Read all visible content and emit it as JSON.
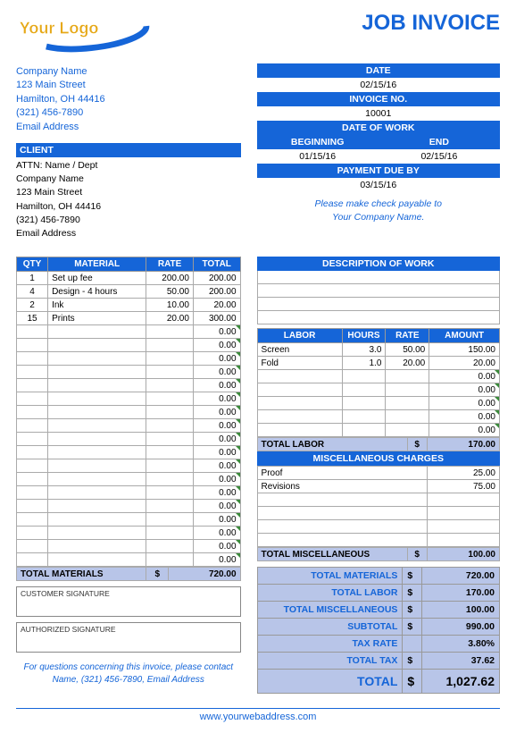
{
  "title": "JOB INVOICE",
  "logo_text_1": "Your",
  "logo_text_2": "Logo",
  "company": {
    "name": "Company Name",
    "street": "123 Main Street",
    "city": "Hamilton, OH  44416",
    "phone": "(321) 456-7890",
    "email": "Email Address"
  },
  "meta": {
    "date_label": "DATE",
    "date": "02/15/16",
    "invno_label": "INVOICE NO.",
    "invno": "10001",
    "dow_label": "DATE OF WORK",
    "beg_label": "BEGINNING",
    "end_label": "END",
    "beg": "01/15/16",
    "end": "02/15/16",
    "due_label": "PAYMENT DUE BY",
    "due": "03/15/16"
  },
  "client": {
    "header": "CLIENT",
    "attn": "ATTN: Name / Dept",
    "name": "Company Name",
    "street": "123 Main Street",
    "city": "Hamilton, OH  44416",
    "phone": "(321) 456-7890",
    "email": "Email Address"
  },
  "pay_note_1": "Please make check payable to",
  "pay_note_2": "Your Company Name.",
  "mat_headers": {
    "qty": "QTY",
    "mat": "MATERIAL",
    "rate": "RATE",
    "total": "TOTAL"
  },
  "materials": [
    {
      "qty": "1",
      "desc": "Set up fee",
      "rate": "200.00",
      "total": "200.00"
    },
    {
      "qty": "4",
      "desc": "Design - 4 hours",
      "rate": "50.00",
      "total": "200.00"
    },
    {
      "qty": "2",
      "desc": "Ink",
      "rate": "10.00",
      "total": "20.00"
    },
    {
      "qty": "15",
      "desc": "Prints",
      "rate": "20.00",
      "total": "300.00"
    }
  ],
  "mat_blank_rows": 18,
  "mat_total_label": "TOTAL MATERIALS",
  "mat_total": "720.00",
  "desc_header": "DESCRIPTION OF WORK",
  "labor_headers": {
    "labor": "LABOR",
    "hours": "HOURS",
    "rate": "RATE",
    "amount": "AMOUNT"
  },
  "labor": [
    {
      "desc": "Screen",
      "hours": "3.0",
      "rate": "50.00",
      "amount": "150.00"
    },
    {
      "desc": "Fold",
      "hours": "1.0",
      "rate": "20.00",
      "amount": "20.00"
    }
  ],
  "labor_blank_rows": 5,
  "labor_total_label": "TOTAL LABOR",
  "labor_total": "170.00",
  "misc_header": "MISCELLANEOUS CHARGES",
  "misc": [
    {
      "desc": "Proof",
      "amount": "25.00"
    },
    {
      "desc": "Revisions",
      "amount": "75.00"
    }
  ],
  "misc_blank_rows": 4,
  "misc_total_label": "TOTAL MISCELLANEOUS",
  "misc_total": "100.00",
  "sig_cust": "CUSTOMER SIGNATURE",
  "sig_auth": "AUTHORIZED SIGNATURE",
  "foot_1": "For questions concerning this invoice, please contact",
  "foot_2": "Name, (321) 456-7890, Email Address",
  "summary": {
    "items": [
      {
        "lbl": "TOTAL MATERIALS",
        "amt": "720.00"
      },
      {
        "lbl": "TOTAL LABOR",
        "amt": "170.00"
      },
      {
        "lbl": "TOTAL MISCELLANEOUS",
        "amt": "100.00"
      },
      {
        "lbl": "SUBTOTAL",
        "amt": "990.00"
      },
      {
        "lbl": "TAX RATE",
        "amt": "3.80%",
        "nocur": true
      },
      {
        "lbl": "TOTAL TAX",
        "amt": "37.62"
      }
    ],
    "total_lbl": "TOTAL",
    "total_amt": "1,027.62"
  },
  "currency": "$",
  "zero": "0.00",
  "web": "www.yourwebaddress.com"
}
